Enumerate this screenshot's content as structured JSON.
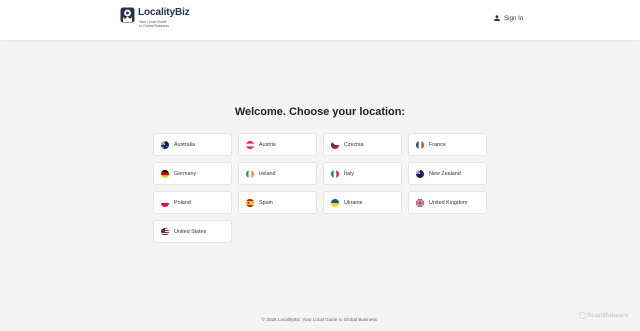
{
  "header": {
    "logo_name": "LocalityBiz",
    "logo_tagline_1": "Your Local Guide",
    "logo_tagline_2": "to Global Business",
    "sign_in_label": "Sign In"
  },
  "main": {
    "title": "Welcome. Choose your location:",
    "locations": [
      {
        "label": "Australia",
        "flag": "flag-australia-icon"
      },
      {
        "label": "Austria",
        "flag": "flag-austria-icon"
      },
      {
        "label": "Czechia",
        "flag": "flag-czechia-icon"
      },
      {
        "label": "France",
        "flag": "flag-france-icon"
      },
      {
        "label": "Germany",
        "flag": "flag-germany-icon"
      },
      {
        "label": "Ireland",
        "flag": "flag-ireland-icon"
      },
      {
        "label": "Italy",
        "flag": "flag-italy-icon"
      },
      {
        "label": "New Zealand",
        "flag": "flag-new-zealand-icon"
      },
      {
        "label": "Poland",
        "flag": "flag-poland-icon"
      },
      {
        "label": "Spain",
        "flag": "flag-spain-icon"
      },
      {
        "label": "Ukraine",
        "flag": "flag-ukraine-icon"
      },
      {
        "label": "United Kingdom",
        "flag": "flag-united-kingdom-icon"
      },
      {
        "label": "United States",
        "flag": "flag-united-states-icon"
      }
    ]
  },
  "footer": {
    "copyright": "© 2026 LocalityBiz. Your Local Guide to Global Business."
  },
  "watermark": {
    "text": "ScanMalware"
  },
  "colors": {
    "brand_dark": "#23344a",
    "page_background": "#f4f4f4",
    "card_border": "#e4e4e4"
  }
}
